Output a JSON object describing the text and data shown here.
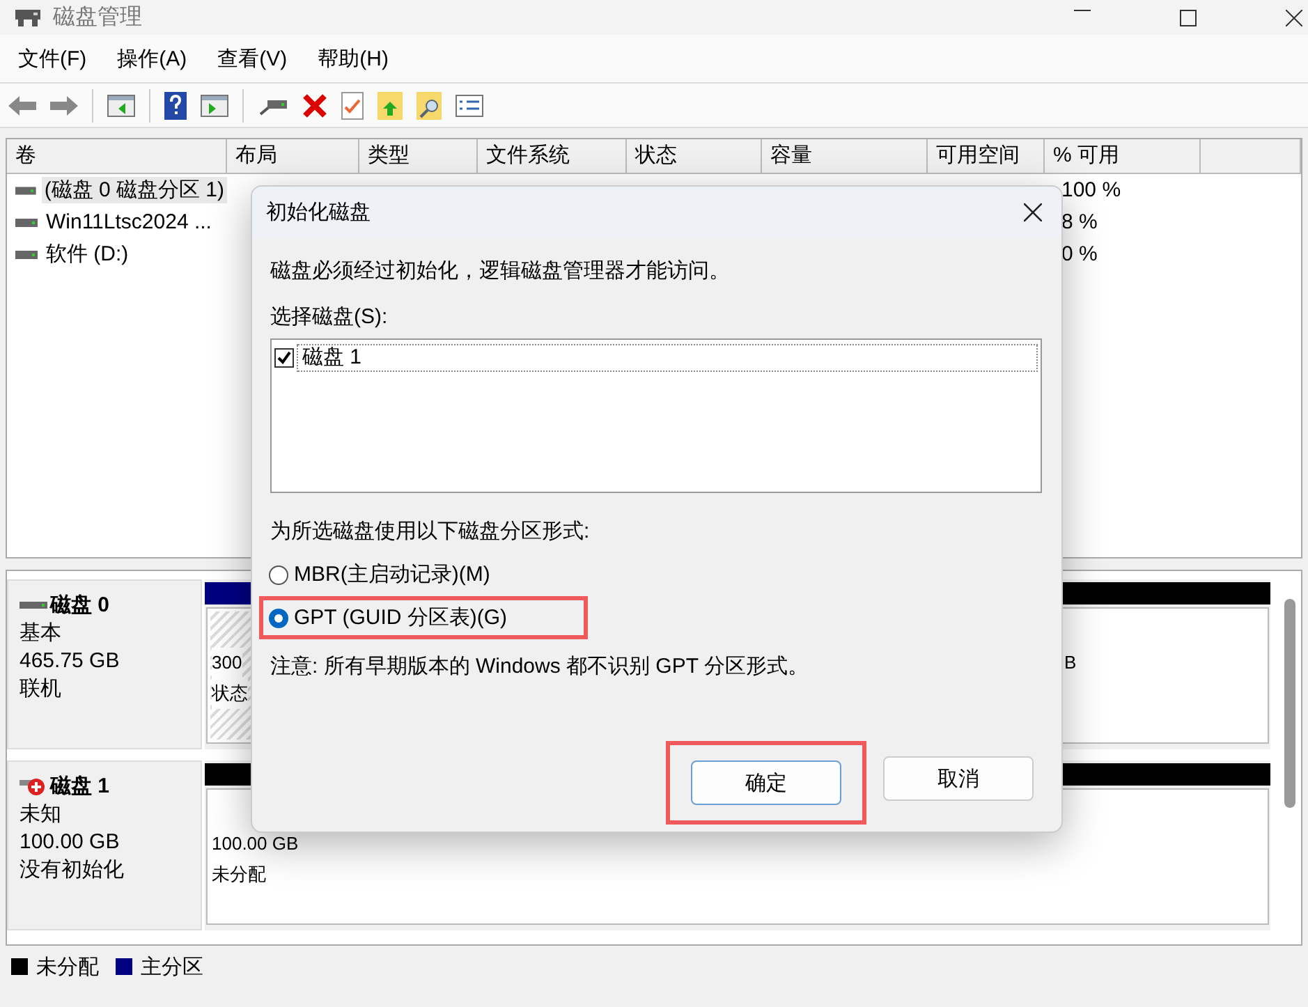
{
  "window": {
    "title": "磁盘管理"
  },
  "menu": [
    "文件(F)",
    "操作(A)",
    "查看(V)",
    "帮助(H)"
  ],
  "volume_table": {
    "columns": [
      {
        "label": "卷"
      },
      {
        "label": "布局"
      },
      {
        "label": "类型"
      },
      {
        "label": "文件系统"
      },
      {
        "label": "状态"
      },
      {
        "label": "容量"
      },
      {
        "label": "可用空间"
      },
      {
        "label": "% 可用"
      }
    ],
    "rows": [
      {
        "volume": "(磁盘 0 磁盘分区 1)",
        "percent_free": "100 %",
        "selected": true
      },
      {
        "volume": "Win11Ltsc2024 ...",
        "percent_free": "8 %",
        "selected": false
      },
      {
        "volume": "软件 (D:)",
        "percent_free": "0 %",
        "selected": false
      }
    ]
  },
  "disks": [
    {
      "name": "磁盘 0",
      "type": "基本",
      "size": "465.75 GB",
      "status": "联机",
      "alert": false,
      "partitions": [
        {
          "kind": "primary",
          "hatched": true,
          "texts": [
            "300",
            "状态"
          ]
        },
        {
          "kind": "unallocated",
          "hatched": false,
          "texts": [
            "B"
          ]
        }
      ]
    },
    {
      "name": "磁盘 1",
      "type": "未知",
      "size": "100.00 GB",
      "status": "没有初始化",
      "alert": true,
      "partitions": [
        {
          "kind": "unallocated",
          "hatched": false,
          "texts": [
            "100.00 GB",
            "未分配"
          ]
        }
      ]
    }
  ],
  "legend": [
    {
      "label": "未分配",
      "color": "#000000"
    },
    {
      "label": "主分区",
      "color": "#000080"
    }
  ],
  "dialog": {
    "title": "初始化磁盘",
    "message": "磁盘必须经过初始化，逻辑磁盘管理器才能访问。",
    "list_label": "选择磁盘(S):",
    "disk_list": [
      {
        "label": "磁盘 1",
        "checked": true
      }
    ],
    "style_label": "为所选磁盘使用以下磁盘分区形式:",
    "options": [
      {
        "label": "MBR(主启动记录)(M)",
        "selected": false,
        "highlighted": false
      },
      {
        "label": "GPT (GUID 分区表)(G)",
        "selected": true,
        "highlighted": true
      }
    ],
    "note": "注意: 所有早期版本的 Windows 都不识别 GPT 分区形式。",
    "buttons": [
      {
        "label": "确定",
        "default": true,
        "highlighted": true
      },
      {
        "label": "取消",
        "default": false,
        "highlighted": false
      }
    ]
  }
}
